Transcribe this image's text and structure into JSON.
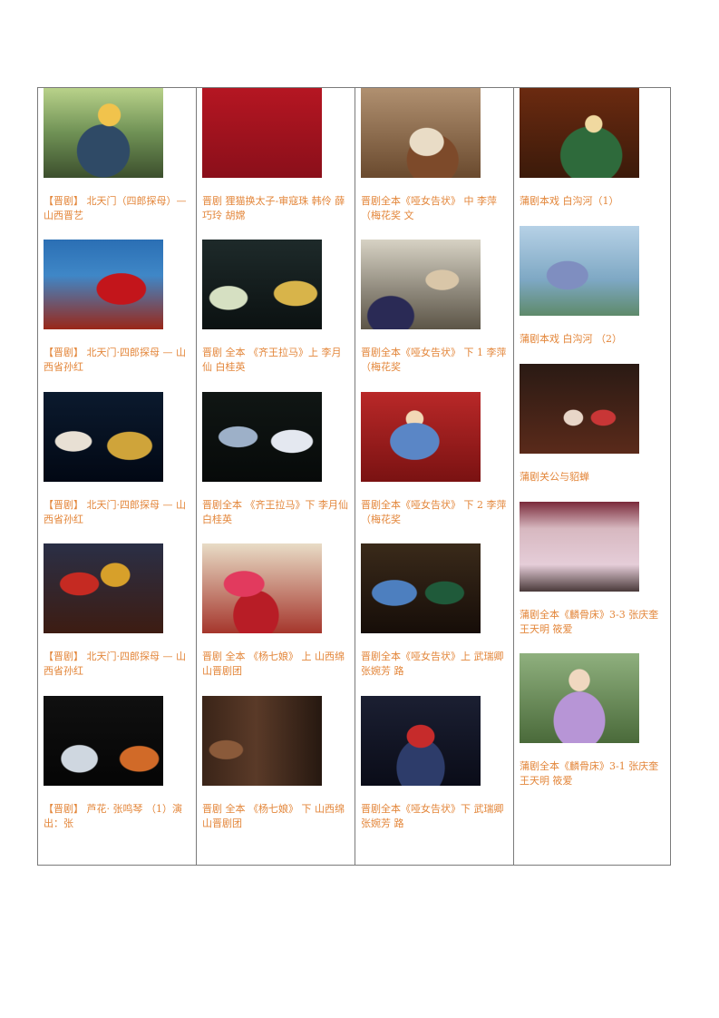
{
  "columns": [
    {
      "entries": [
        {
          "thumb_icon": "jinju-performer-photo",
          "parts": [
            {
              "text": "【晋剧】 北天门（四郎探母）— 山西晋艺",
              "color": "orange"
            }
          ]
        },
        {
          "thumb_icon": "jinju-performer-photo",
          "parts": [
            {
              "text": "【晋剧】 北天门·四郎探母 — 山西省孙红",
              "color": "orange"
            }
          ]
        },
        {
          "thumb_icon": "jinju-stage-photo",
          "parts": [
            {
              "text": "【晋剧】 北天门·四郎探母 — 山西省孙红",
              "color": "orange"
            }
          ]
        },
        {
          "thumb_icon": "jinju-stage-photo",
          "parts": [
            {
              "text": "【晋剧】 北天门·四郎探母 — 山西省孙红",
              "color": "orange"
            }
          ]
        },
        {
          "thumb_icon": "jinju-stage-photo",
          "parts": [
            {
              "text": "【晋剧】 芦花· 张鸣琴 （1）演出：张",
              "color": "orange"
            }
          ]
        }
      ]
    },
    {
      "entries": [
        {
          "thumb_icon": "title-card-photo",
          "parts": [
            {
              "text": "晋剧 狸猫换太子-审寇珠 韩伶 薛巧玲 胡嫦",
              "color": "orange"
            }
          ]
        },
        {
          "thumb_icon": "jinju-stage-photo",
          "parts": [
            {
              "text": "晋剧 全本 《齐王拉马》上 李月仙 白桂英",
              "color": "orange"
            }
          ]
        },
        {
          "thumb_icon": "jinju-stage-photo",
          "parts": [
            {
              "text": "晋剧全本 《齐王拉马》下 李月仙 白桂英",
              "color": "orange"
            }
          ]
        },
        {
          "thumb_icon": "jinju-performer-photo",
          "parts": [
            {
              "text": "晋剧 全本 《杨七娘》 上 山西绵山晋剧团",
              "color": "orange"
            }
          ]
        },
        {
          "thumb_icon": "jinju-stage-photo",
          "parts": [
            {
              "text": "晋剧 全本 《杨七娘》 下 山西绵山晋剧团",
              "color": "orange"
            }
          ]
        }
      ]
    },
    {
      "entries": [
        {
          "thumb_icon": "jinju-performer-photo",
          "parts": [
            {
              "text": "晋剧全本《哑女告状》 中 李萍 （梅花奖 文",
              "color": "orange"
            }
          ]
        },
        {
          "thumb_icon": "jinju-stage-photo",
          "parts": [
            {
              "text": "晋剧全本《哑女告状》 下 1 李萍 （梅花奖",
              "color": "orange"
            }
          ]
        },
        {
          "thumb_icon": "jinju-performer-photo",
          "parts": [
            {
              "text": "晋剧全本《哑女告状》 下 2 李萍 （梅花奖",
              "color": "orange"
            }
          ]
        },
        {
          "thumb_icon": "jinju-stage-photo",
          "parts": [
            {
              "text": "晋剧全本《哑女告状》上 武瑞卿 张婉芳 路",
              "color": "orange"
            }
          ]
        },
        {
          "thumb_icon": "jinju-stage-photo",
          "parts": [
            {
              "text": "晋剧全本《哑女告状》下 武瑞卿 张婉芳 路",
              "color": "orange"
            }
          ]
        }
      ]
    },
    {
      "entries": [
        {
          "thumb_icon": "puju-performer-photo",
          "parts": [
            {
              "text": "蒲剧本戏 白沟河（1）",
              "color": "orange"
            }
          ]
        },
        {
          "thumb_icon": "puju-stage-photo",
          "parts": [
            {
              "text": "蒲剧本戏 白沟河 （2）",
              "color": "orange"
            }
          ]
        },
        {
          "thumb_icon": "puju-stage-photo",
          "parts": [
            {
              "text": "蒲剧关公与貂蝉",
              "color": "orange"
            }
          ]
        },
        {
          "thumb_icon": "puju-stage-photo",
          "parts": [
            {
              "text": "蒲剧全本《麟骨床》3-3 张庆奎 王天明 筱爱",
              "color": "orange"
            }
          ]
        },
        {
          "thumb_icon": "puju-performer-photo",
          "parts": [
            {
              "text": "蒲剧全本《麟骨床》3-1 张庆奎 王天明 筱爱",
              "color": "orange"
            }
          ]
        }
      ]
    }
  ],
  "colors": {
    "orange": "#e3863a",
    "blue": "#2e6ea8",
    "border": "#7a7a7a"
  }
}
